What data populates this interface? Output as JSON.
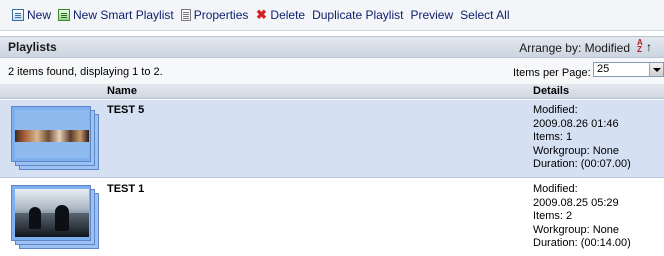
{
  "toolbar": {
    "buttons": [
      {
        "label": "New",
        "icon": "new-playlist-icon"
      },
      {
        "label": "New Smart Playlist",
        "icon": "smart-playlist-icon"
      },
      {
        "label": "Properties",
        "icon": "properties-icon"
      },
      {
        "label": "Delete",
        "icon": "delete-icon"
      },
      {
        "label": "Duplicate Playlist"
      },
      {
        "label": "Preview"
      },
      {
        "label": "Select All"
      }
    ]
  },
  "header": {
    "title": "Playlists",
    "arrange_by": "Arrange by: Modified",
    "sort_icon": "sort-az-icon"
  },
  "info": {
    "found_text": "2 items found, displaying 1 to 2.",
    "items_per_page_label": "Items per Page:",
    "items_per_page_value": "25"
  },
  "columns": {
    "name": "Name",
    "details": "Details"
  },
  "rows": [
    {
      "name": "TEST 5",
      "details": [
        "Modified:",
        "2009.08.26 01:46",
        "Items: 1",
        "Workgroup: None",
        "Duration: (00:07.00)"
      ]
    },
    {
      "name": "TEST 1",
      "details": [
        "Modified:",
        "2009.08.25 05:29",
        "Items: 2",
        "Workgroup: None",
        "Duration: (00:14.00)"
      ]
    }
  ],
  "colors": {
    "selected_row": "#d5e0f2",
    "toolbar_text": "#0b1f6e",
    "delete_icon": "#d42020"
  }
}
